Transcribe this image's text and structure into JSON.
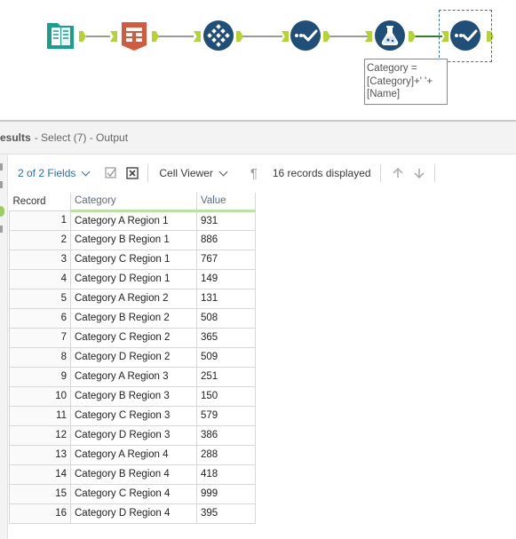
{
  "canvas": {
    "annotation": [
      "Category =",
      "[Category]+' '+",
      "[Name]"
    ]
  },
  "results": {
    "title": "esults",
    "subtitle": "- Select (7) - Output"
  },
  "toolbar": {
    "fields_label": "2 of 2 Fields",
    "viewer_label": "Cell Viewer",
    "records_label": "16 records displayed"
  },
  "grid": {
    "headers": {
      "record": "Record",
      "category": "Category",
      "value": "Value"
    },
    "rows": [
      {
        "record": "1",
        "category": "Category A Region 1",
        "value": "931"
      },
      {
        "record": "2",
        "category": "Category B Region 1",
        "value": "886"
      },
      {
        "record": "3",
        "category": "Category C Region 1",
        "value": "767"
      },
      {
        "record": "4",
        "category": "Category D Region 1",
        "value": "149"
      },
      {
        "record": "5",
        "category": "Category A Region 2",
        "value": "131"
      },
      {
        "record": "6",
        "category": "Category B Region 2",
        "value": "508"
      },
      {
        "record": "7",
        "category": "Category C Region 2",
        "value": "365"
      },
      {
        "record": "8",
        "category": "Category D Region 2",
        "value": "509"
      },
      {
        "record": "9",
        "category": "Category A Region 3",
        "value": "251"
      },
      {
        "record": "10",
        "category": "Category B Region 3",
        "value": "150"
      },
      {
        "record": "11",
        "category": "Category C Region 3",
        "value": "579"
      },
      {
        "record": "12",
        "category": "Category D Region 3",
        "value": "386"
      },
      {
        "record": "13",
        "category": "Category A Region 4",
        "value": "288"
      },
      {
        "record": "14",
        "category": "Category B Region 4",
        "value": "418"
      },
      {
        "record": "15",
        "category": "Category C Region 4",
        "value": "999"
      },
      {
        "record": "16",
        "category": "Category D Region 4",
        "value": "395"
      }
    ]
  },
  "icons": {
    "tool_1": "input-book-icon",
    "tool_2": "text-to-columns-icon",
    "tool_3": "transpose-icon",
    "tool_4": "select-check-icon",
    "tool_5": "formula-flask-icon",
    "tool_6": "select-check-icon"
  },
  "colors": {
    "input_tool": "#1a9e8f",
    "parse_tool": "#d35a3c",
    "transform_tool": "#1f4e79",
    "formula_tool": "#1f4e79",
    "anchor": "#b5d334",
    "active_connection": "#2e7d32"
  }
}
